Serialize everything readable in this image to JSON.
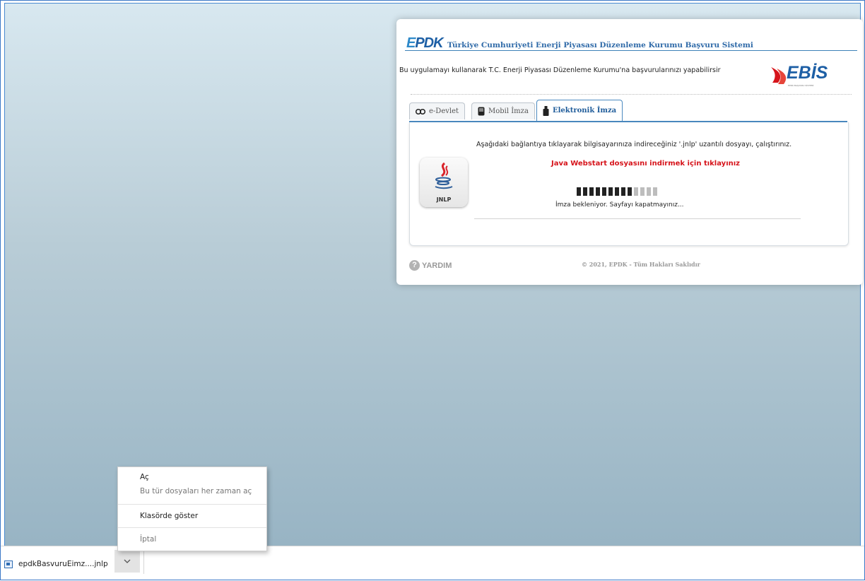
{
  "app": {
    "logo_text": "EPDK",
    "title": "Türkiye Cumhuriyeti Enerji Piyasası Düzenleme Kurumu Başvuru Sistemi",
    "subtitle": "Bu uygulamayı kullanarak T.C. Enerji Piyasası Düzenleme Kurumu'na başvurularınızı yapabilirsir",
    "brand_logo": "EBİS",
    "brand_colors": {
      "primary": "#1d5fa5",
      "link_red": "#d6141b",
      "accent_blue": "#4b8ac0"
    }
  },
  "tabs": [
    {
      "label": "e-Devlet",
      "icon": "edevlet-icon",
      "active": false
    },
    {
      "label": "Mobil İmza",
      "icon": "mobile-phone-icon",
      "active": false
    },
    {
      "label": "Elektronik İmza",
      "icon": "usb-token-icon",
      "active": true
    }
  ],
  "panel": {
    "instruction": "Aşağıdaki bağlantıya tıklayarak bilgisayarınıza indireceğiniz '.jnlp' uzantılı dosyayı, çalıştırınız.",
    "download_link": "Java Webstart dosyasını indirmek için tıklayınız",
    "file_icon_label": "JNLP",
    "progress": {
      "filled": 9,
      "total": 13
    },
    "status": "İmza bekleniyor. Sayfayı kapatmayınız..."
  },
  "footer": {
    "help": "YARDIM",
    "copyright": "© 2021, EPDK - Tüm Hakları Saklıdır"
  },
  "context_menu": {
    "open": "Aç",
    "always_open": "Bu tür dosyaları her zaman aç",
    "show_in_folder": "Klasörde göster",
    "cancel": "İptal"
  },
  "download_bar": {
    "filename": "epdkBasvuruEimz....jnlp"
  }
}
